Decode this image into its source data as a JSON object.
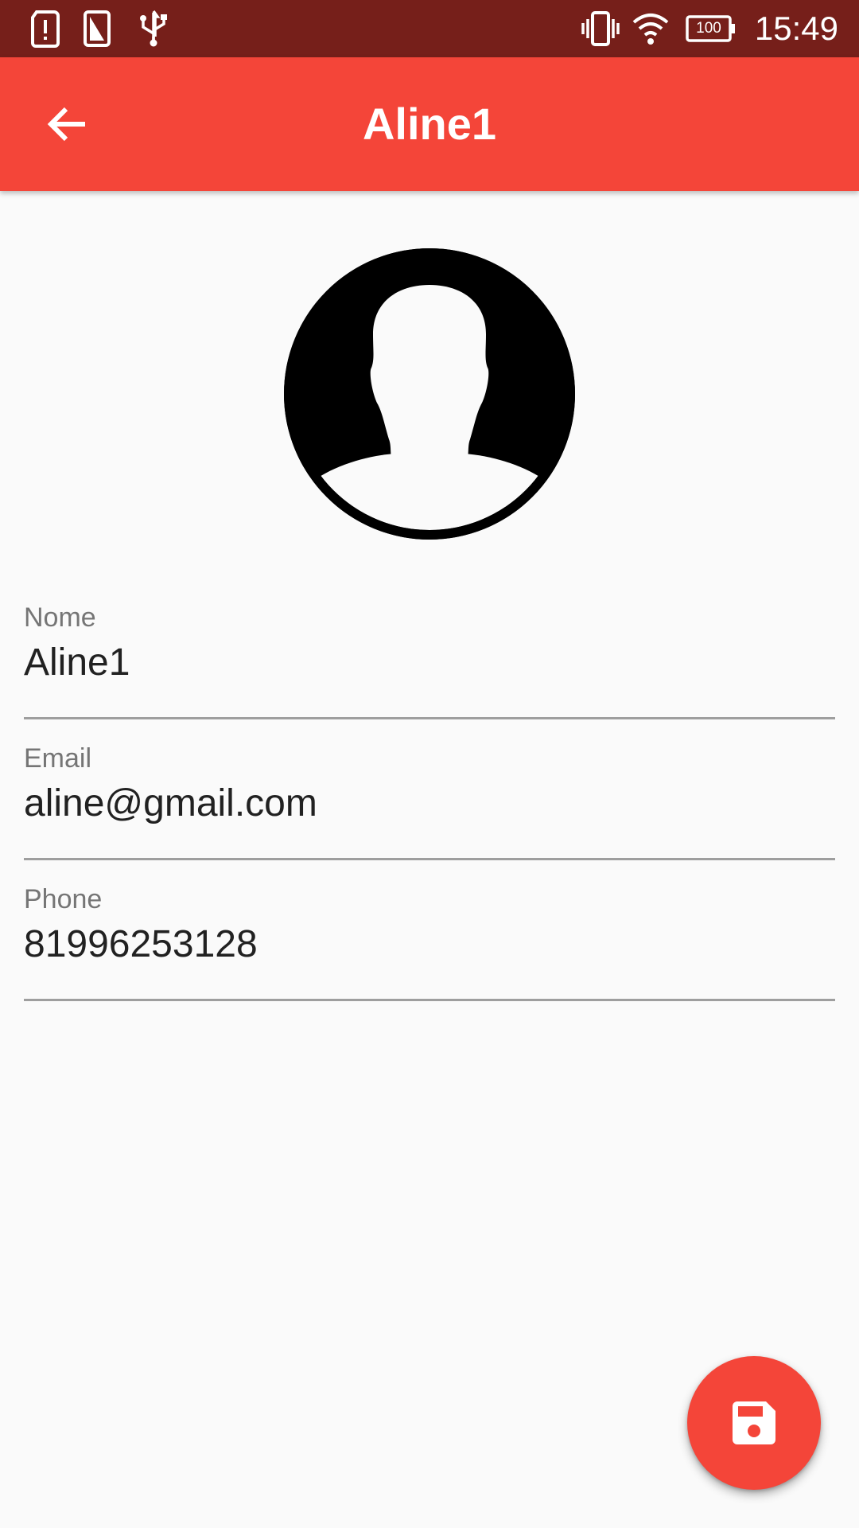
{
  "status_bar": {
    "time": "15:49",
    "battery_level": "100",
    "icons": [
      "alert-card-icon",
      "sim-card-icon",
      "usb-icon",
      "vibrate-icon",
      "wifi-icon",
      "battery-icon"
    ]
  },
  "app_bar": {
    "title": "Aline1",
    "back_icon": "arrow-back-icon",
    "background_color": "#f44539"
  },
  "avatar": {
    "icon": "person-silhouette-icon"
  },
  "form": {
    "fields": [
      {
        "label": "Nome",
        "value": "Aline1"
      },
      {
        "label": "Email",
        "value": "aline@gmail.com"
      },
      {
        "label": "Phone",
        "value": "81996253128"
      }
    ]
  },
  "fab": {
    "icon": "save-icon",
    "color": "#f44539"
  },
  "colors": {
    "status_bar": "#761f1a",
    "accent": "#f44539",
    "background": "#fafafa"
  }
}
